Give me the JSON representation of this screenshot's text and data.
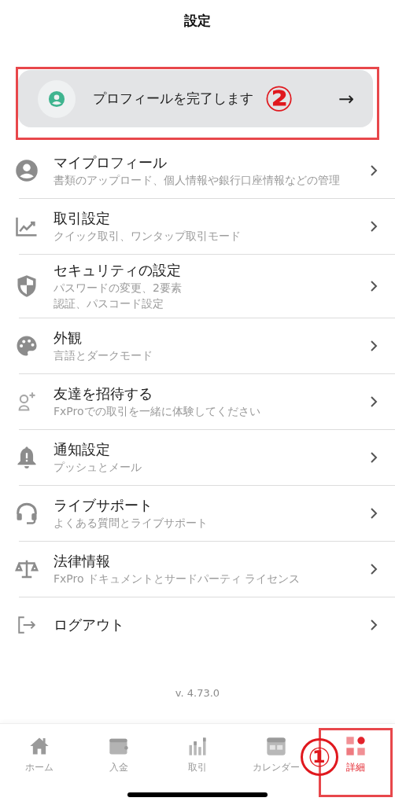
{
  "header": {
    "title": "設定"
  },
  "profile_banner": {
    "label": "プロフィールを完了します",
    "arrow": "→"
  },
  "settings": [
    {
      "title": "マイプロフィール",
      "subtitle": "書類のアップロード、個人情報や銀行口座情報などの管理"
    },
    {
      "title": "取引設定",
      "subtitle": "クイック取引、ワンタップ取引モード"
    },
    {
      "title": "セキュリティの設定",
      "subtitle_lines": [
        "パスワードの変更、2要素",
        "認証、パスコード設定"
      ]
    },
    {
      "title": "外観",
      "subtitle": "言語とダークモード"
    },
    {
      "title": "友達を招待する",
      "subtitle": "FxProでの取引を一緒に体験してください"
    },
    {
      "title": "通知設定",
      "subtitle": "プッシュとメール"
    },
    {
      "title": "ライブサポート",
      "subtitle": "よくある質問とライブサポート"
    },
    {
      "title": "法律情報",
      "subtitle": "FxPro ドキュメントとサードパーティ ライセンス"
    },
    {
      "title": "ログアウト"
    }
  ],
  "version": "v. 4.73.0",
  "tab_bar": [
    {
      "label": "ホーム",
      "selected": false
    },
    {
      "label": "入金",
      "selected": false
    },
    {
      "label": "取引",
      "selected": false
    },
    {
      "label": "カレンダー",
      "selected": false
    },
    {
      "label": "詳細",
      "selected": true
    }
  ],
  "annotations": [
    {
      "label": "②"
    },
    {
      "label": "①"
    }
  ]
}
